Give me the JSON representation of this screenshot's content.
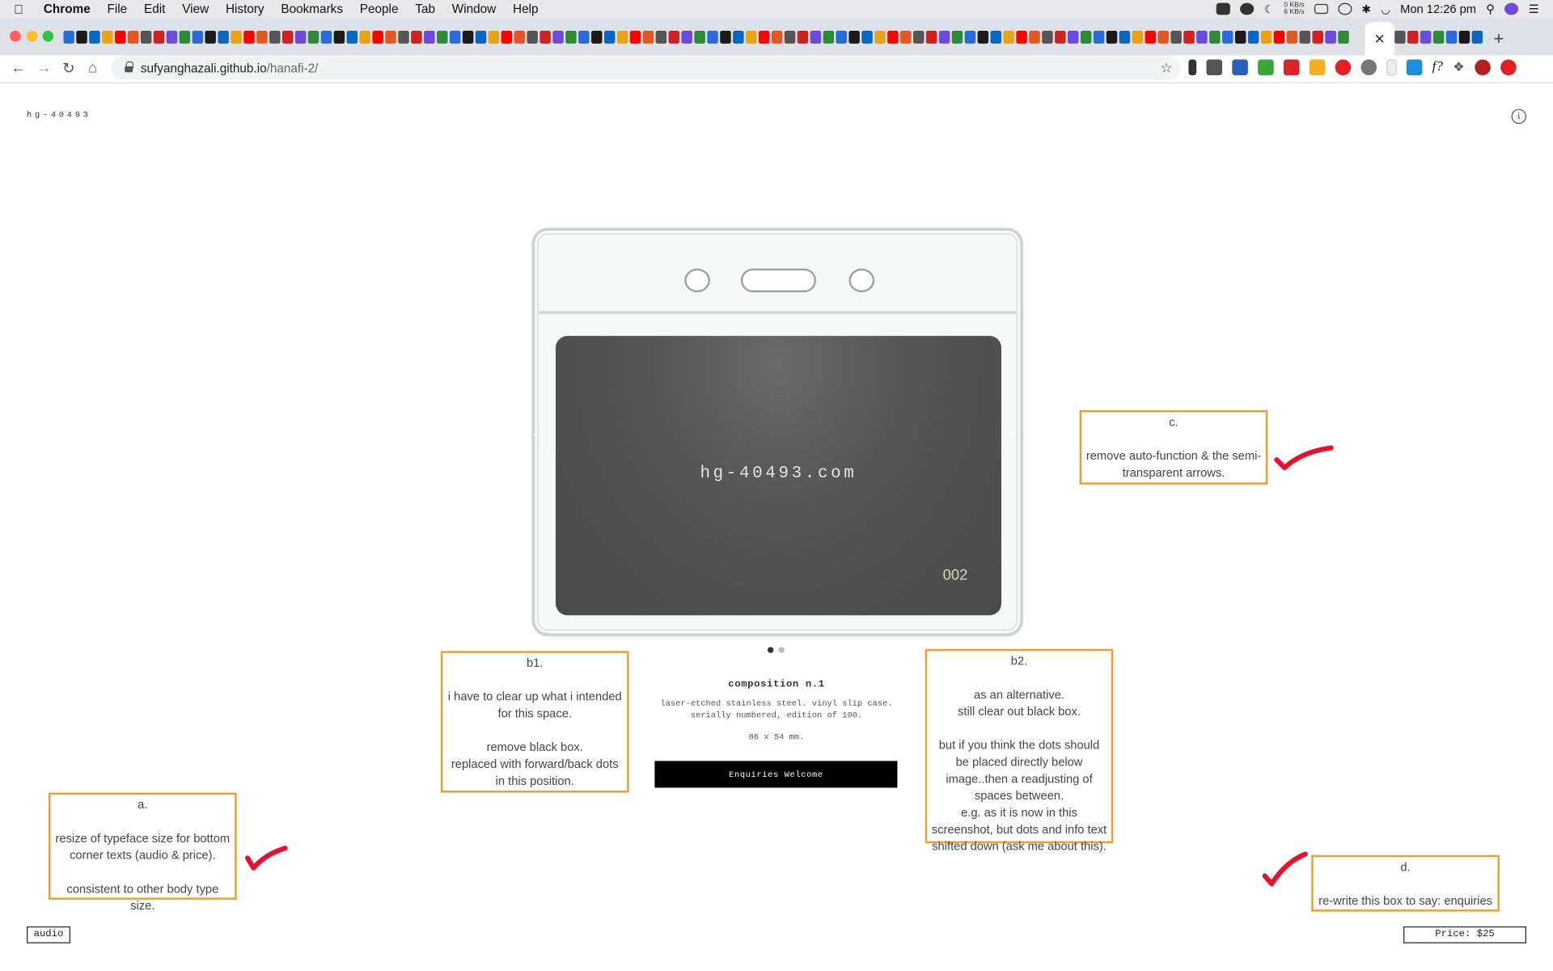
{
  "menubar": {
    "app": "Chrome",
    "items": [
      "File",
      "Edit",
      "View",
      "History",
      "Bookmarks",
      "People",
      "Tab",
      "Window",
      "Help"
    ],
    "net_up": "0 KB/s",
    "net_down": "6 KB/s",
    "clock": "Mon 12:26 pm"
  },
  "browser": {
    "url_host": "sufyanghazali.github.io",
    "url_path": "/hanafi-2/",
    "active_tab_close": "✕",
    "new_tab": "+"
  },
  "page": {
    "site_title": "hg-40493",
    "info_icon": "i",
    "card_text": "hg-40493.com",
    "card_number": "002",
    "slider": {
      "total": 2,
      "active": 1
    },
    "product_title": "composition n.1",
    "product_desc_1": "laser-etched stainless steel. vinyl slip case.",
    "product_desc_2": "serially numbered, edition of 100.",
    "product_size": "86 x 54 mm.",
    "enquiries_label": "Enquiries Welcome",
    "audio_label": "audio",
    "price_label": "Price: $25"
  },
  "annotations": {
    "a": "a.\n\nresize of typeface size for bottom corner texts (audio & price).\n\nconsistent to other body type size.",
    "b1": "b1.\n\ni have to clear up what i intended for this space.\n\nremove black box.\nreplaced with forward/back dots in this position.",
    "b2": "b2.\n\nas an alternative.\nstill clear out black box.\n\nbut if you think the dots should be placed directly below image..then a readjusting of spaces between.\ne.g. as it is now in this screenshot, but dots and info text shifted down (ask me about this).",
    "c": "c.\n\nremove auto-function & the semi-transparent arrows.",
    "d": "d.\n\nre-write this box to say: enquiries"
  },
  "colors": {
    "annotation_border": "#f39c2b",
    "checkmark": "#e8102a",
    "button_bg": "#000000"
  }
}
